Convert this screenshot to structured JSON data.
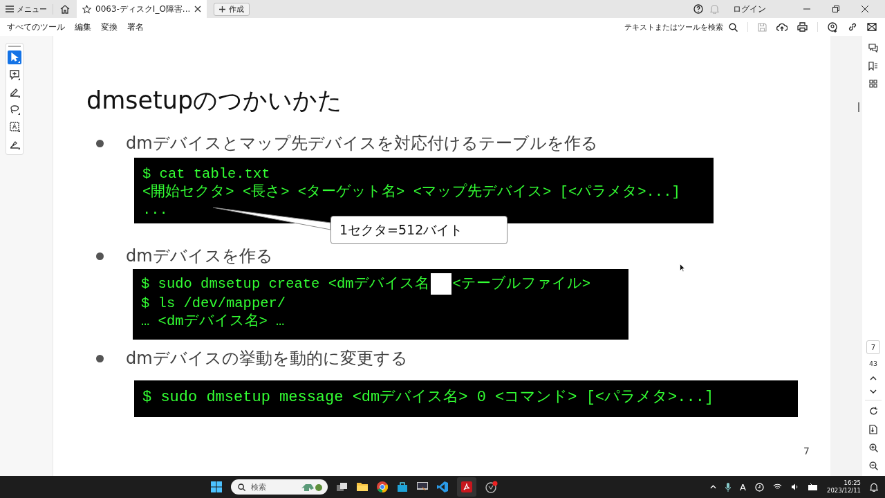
{
  "titlebar": {
    "menu": "メニュー",
    "tab": {
      "title": "0063-ディスクI_O障害...",
      "selected": true
    },
    "create": "作成",
    "login": "ログイン"
  },
  "toolbar": {
    "items": [
      "すべてのツール",
      "編集",
      "変換",
      "署名"
    ],
    "search": "テキストまたはツールを検索"
  },
  "tools": [
    {
      "kind": "select",
      "selected": true
    },
    {
      "kind": "comment",
      "selected": false
    },
    {
      "kind": "draw",
      "selected": false
    },
    {
      "kind": "lasso",
      "selected": false
    },
    {
      "kind": "text",
      "selected": false
    },
    {
      "kind": "sign",
      "selected": false
    }
  ],
  "slide": {
    "title": "dmsetupのつかいかた",
    "sections": [
      {
        "bullet": "dmデバイスとマップ先デバイスを対応付けるテーブルを作る",
        "code": [
          "$ cat table.txt",
          "<開始セクタ> <長さ> <ターゲット名> <マップ先デバイス> [<パラメタ>...]",
          "..."
        ]
      },
      {
        "bullet": "dmデバイスを作る",
        "code": [
          [
            "$ sudo dmsetup create <dmデバイス名",
            "<テーブルファイル>"
          ],
          "$ ls /dev/mapper/",
          "… <dmデバイス名> …"
        ]
      },
      {
        "bullet": "dmデバイスの挙動を動的に変更する",
        "code": [
          "$ sudo dmsetup message <dmデバイス名> 0 <コマンド> [<パラメタ>...]"
        ]
      }
    ],
    "callout": "1セクタ=512バイト",
    "page_number": "7"
  },
  "page_nav": {
    "current": "7",
    "total": "43"
  },
  "taskbar": {
    "search_placeholder": "検索",
    "ime": "A",
    "time": "16:25",
    "date": "2023/12/11"
  }
}
